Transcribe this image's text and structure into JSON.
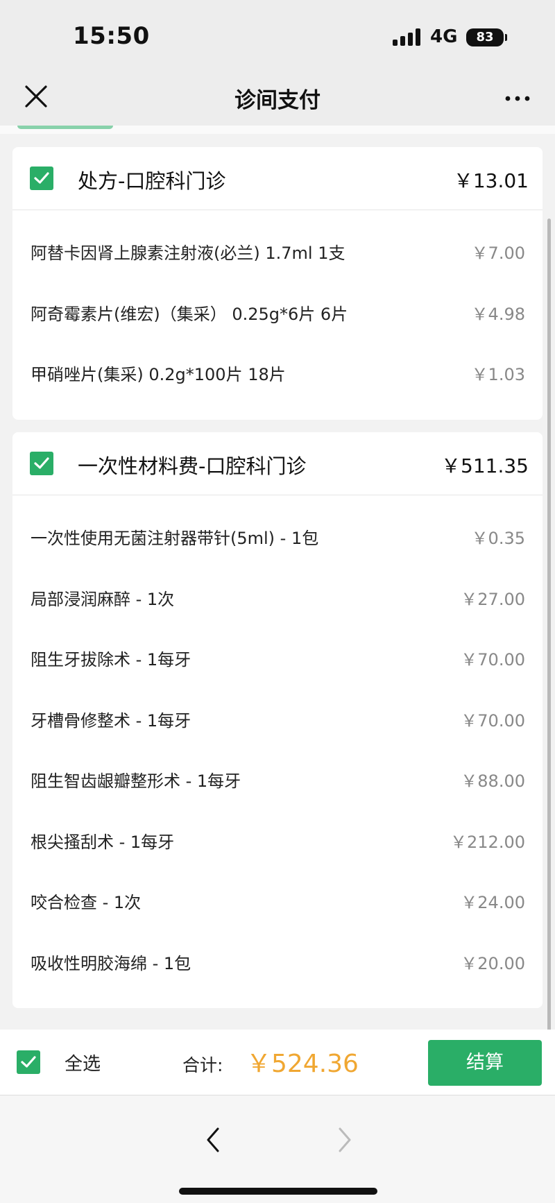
{
  "status_bar": {
    "time": "15:50",
    "network": "4G",
    "battery": "83"
  },
  "nav": {
    "title": "诊间支付"
  },
  "sections": [
    {
      "title": "处方-口腔科门诊",
      "total": "￥13.01",
      "checked": true,
      "items": [
        {
          "name": "阿替卡因肾上腺素注射液(必兰) 1.7ml 1支",
          "price": "￥7.00"
        },
        {
          "name": "阿奇霉素片(维宏)（集采） 0.25g*6片 6片",
          "price": "￥4.98"
        },
        {
          "name": "甲硝唑片(集采) 0.2g*100片 18片",
          "price": "￥1.03"
        }
      ]
    },
    {
      "title": "一次性材料费-口腔科门诊",
      "total": "￥511.35",
      "checked": true,
      "items": [
        {
          "name": "一次性使用无菌注射器带针(5ml) - 1包",
          "price": "￥0.35"
        },
        {
          "name": "局部浸润麻醉 - 1次",
          "price": "￥27.00"
        },
        {
          "name": "阻生牙拔除术 - 1每牙",
          "price": "￥70.00"
        },
        {
          "name": "牙槽骨修整术 - 1每牙",
          "price": "￥70.00"
        },
        {
          "name": "阻生智齿龈瓣整形术 - 1每牙",
          "price": "￥88.00"
        },
        {
          "name": "根尖搔刮术 - 1每牙",
          "price": "￥212.00"
        },
        {
          "name": "咬合检查 - 1次",
          "price": "￥24.00"
        },
        {
          "name": "吸收性明胶海绵 - 1包",
          "price": "￥20.00"
        }
      ]
    }
  ],
  "checkout": {
    "select_all_label": "全选",
    "select_all_checked": true,
    "total_label": "合计:",
    "total_amount": "￥524.36",
    "button_label": "结算"
  },
  "colors": {
    "accent_green": "#2aae67",
    "total_orange": "#f0a732",
    "background": "#ededed"
  },
  "icons": {
    "close": "close-icon",
    "more": "more-icon",
    "checkbox": "checkmark-icon",
    "back": "chevron-left-icon",
    "forward": "chevron-right-icon"
  }
}
